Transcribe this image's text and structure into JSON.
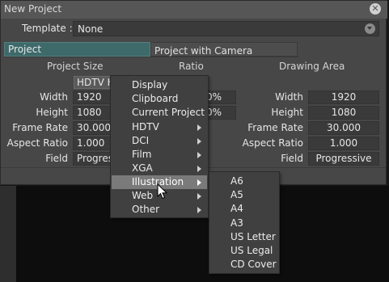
{
  "dialog": {
    "title": "New Project",
    "template_label": "Template :",
    "template_value": "None",
    "tabs": [
      "Project",
      "Project with Camera"
    ],
    "project_size": {
      "heading": "Project Size",
      "preset_label": "HDTV  H",
      "width_label": "Width",
      "width_value": "1920",
      "height_label": "Height",
      "height_value": "1080",
      "framerate_label": "Frame Rate",
      "framerate_value": "30.000",
      "aspect_label": "Aspect Ratio",
      "aspect_value": "1.000",
      "field_label": "Field",
      "field_value": "Progres"
    },
    "ratio": {
      "heading": "Ratio",
      "value1": "0%",
      "value2": "0%"
    },
    "drawing_area": {
      "heading": "Drawing Area",
      "width_label": "Width",
      "width_value": "1920",
      "height_label": "Height",
      "height_value": "1080",
      "framerate_label": "Frame Rate",
      "framerate_value": "30.000",
      "aspect_label": "Aspect Ratio",
      "aspect_value": "1.000",
      "field_label": "Field",
      "field_value": "Progressive"
    }
  },
  "preset_menu": {
    "items": [
      {
        "label": "Display",
        "submenu": false
      },
      {
        "label": "Clipboard",
        "submenu": false
      },
      {
        "label": "Current Project",
        "submenu": false
      },
      {
        "label": "HDTV",
        "submenu": true
      },
      {
        "label": "DCI",
        "submenu": true
      },
      {
        "label": "Film",
        "submenu": true
      },
      {
        "label": "XGA",
        "submenu": true
      },
      {
        "label": "Illustration",
        "submenu": true,
        "highlighted": true
      },
      {
        "label": "Web",
        "submenu": true
      },
      {
        "label": "Other",
        "submenu": true
      }
    ]
  },
  "illustration_submenu": {
    "items": [
      "A6",
      "A5",
      "A4",
      "A3",
      "US Letter",
      "US Legal",
      "CD Cover"
    ]
  },
  "colors": {
    "dialog_bg": "#474747",
    "active_tab": "#3e6a6a",
    "menu_highlight": "#7a7a7a"
  },
  "icons": {
    "close": "close-icon",
    "dropdown": "chevron-down-icon",
    "submenu": "chevron-right-icon",
    "pointer": "mouse-cursor-icon"
  }
}
